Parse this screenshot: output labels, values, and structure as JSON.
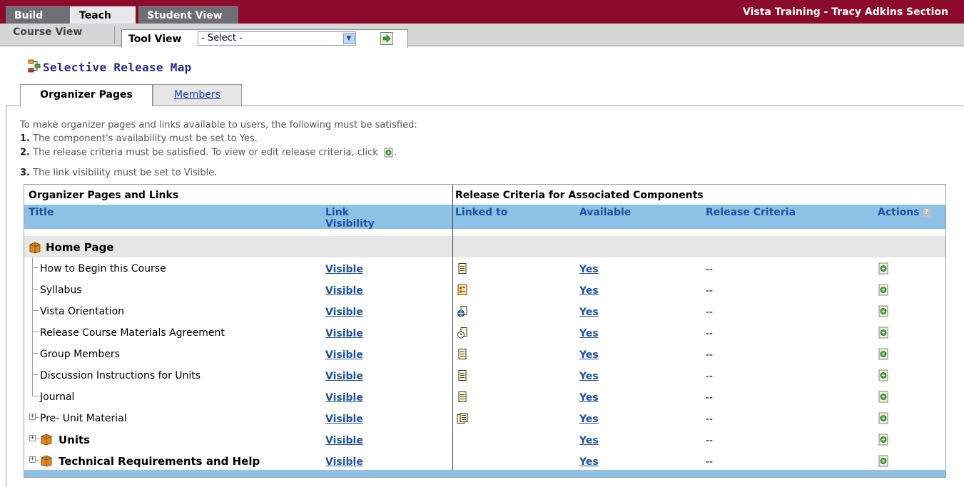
{
  "tabs": {
    "build": "Build",
    "teach": "Teach",
    "student_view": "Student View"
  },
  "section_title": "Vista Training - Tracy Adkins Section",
  "subbar": {
    "course_view": "Course View",
    "tool_view": "Tool View",
    "tool_select": "- Select -"
  },
  "page_title": "Selective Release Map",
  "inner_tabs": {
    "organizer_pages": "Organizer Pages",
    "members": "Members"
  },
  "instructions": {
    "intro": "To make organizer pages and links available to users, the following must be satisfied:",
    "n1": "1.",
    "s1": "The component's availability must be set to Yes.",
    "n2": "2.",
    "s2": "The release criteria must be satisfied. To view or edit release criteria, click",
    "s2_end": ".",
    "n3": "3.",
    "s3": "The link visibility must be set to Visible."
  },
  "table": {
    "header_left": "Organizer Pages and Links",
    "header_right": "Release Criteria for Associated Components",
    "col_title": "Title",
    "col_link_visibility_1": "Link",
    "col_link_visibility_2": "Visibility",
    "col_linked_to": "Linked to",
    "col_available": "Available",
    "col_release_criteria": "Release Criteria",
    "col_actions": "Actions",
    "help_badge": "?",
    "group_home": "Home Page",
    "rows": [
      {
        "title": "How to Begin this Course",
        "visibility": "Visible",
        "linked_icon": "page-icon",
        "available": "Yes",
        "criteria": "--"
      },
      {
        "title": "Syllabus",
        "visibility": "Visible",
        "linked_icon": "syllabus-icon",
        "available": "Yes",
        "criteria": "--"
      },
      {
        "title": "Vista Orientation",
        "visibility": "Visible",
        "linked_icon": "web-link-icon",
        "available": "Yes",
        "criteria": "--"
      },
      {
        "title": "Release Course Materials Agreement",
        "visibility": "Visible",
        "linked_icon": "assessment-icon",
        "available": "Yes",
        "criteria": "--"
      },
      {
        "title": "Group Members",
        "visibility": "Visible",
        "linked_icon": "page-icon",
        "available": "Yes",
        "criteria": "--"
      },
      {
        "title": "Discussion Instructions for Units",
        "visibility": "Visible",
        "linked_icon": "page-icon",
        "available": "Yes",
        "criteria": "--"
      },
      {
        "title": "Journal",
        "visibility": "Visible",
        "linked_icon": "page-icon",
        "available": "Yes",
        "criteria": "--"
      },
      {
        "title": "Pre- Unit Material",
        "visibility": "Visible",
        "linked_icon": "content-module-icon",
        "available": "Yes",
        "criteria": "--"
      },
      {
        "title": "Units",
        "visibility": "Visible",
        "linked_icon": "",
        "available": "Yes",
        "criteria": "--"
      },
      {
        "title": "Technical Requirements and Help",
        "visibility": "Visible",
        "linked_icon": "",
        "available": "Yes",
        "criteria": "--"
      }
    ]
  },
  "colors": {
    "top_bar": "#8c0b2c",
    "header_blue": "#8ec1e6",
    "link_blue": "#1f4f9f"
  }
}
